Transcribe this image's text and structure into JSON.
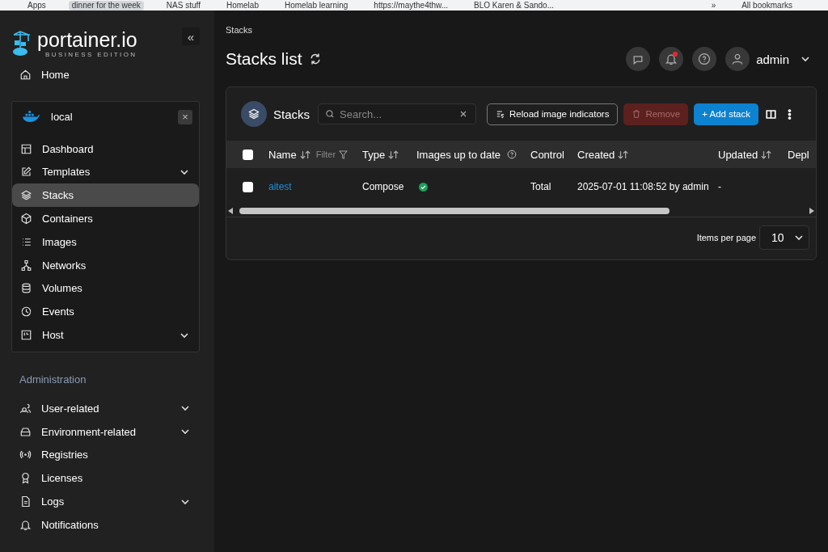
{
  "bookmarks": [
    {
      "label": "Apps",
      "selected": false
    },
    {
      "label": "dinner for the week",
      "selected": true
    },
    {
      "label": "NAS stuff",
      "selected": false
    },
    {
      "label": "Homelab",
      "selected": false
    },
    {
      "label": "Homelab learning",
      "selected": false
    },
    {
      "label": "https://maythe4thw...",
      "selected": false
    },
    {
      "label": "BLO Karen & Sando...",
      "selected": false
    }
  ],
  "bookmarks_more": "»",
  "all_bookmarks": "All bookmarks",
  "logo": {
    "name": "portainer.io",
    "edition": "BUSINESS EDITION"
  },
  "collapse_symbol": "«",
  "home": "Home",
  "environment": {
    "name": "local",
    "close": "×",
    "items": [
      {
        "label": "Dashboard",
        "selected": false
      },
      {
        "label": "Templates",
        "selected": false,
        "expanded": false
      },
      {
        "label": "Stacks",
        "selected": true
      },
      {
        "label": "Containers",
        "selected": false
      },
      {
        "label": "Images",
        "selected": false
      },
      {
        "label": "Networks",
        "selected": false
      },
      {
        "label": "Volumes",
        "selected": false
      },
      {
        "label": "Events",
        "selected": false
      },
      {
        "label": "Host",
        "selected": false,
        "expanded": false
      }
    ]
  },
  "admin_heading": "Administration",
  "admin_items": [
    {
      "label": "User-related",
      "expanded": false
    },
    {
      "label": "Environment-related",
      "expanded": false
    },
    {
      "label": "Registries"
    },
    {
      "label": "Licenses"
    },
    {
      "label": "Logs",
      "expanded": false
    },
    {
      "label": "Notifications"
    }
  ],
  "breadcrumb": "Stacks",
  "page_title": "Stacks list",
  "notifications": {
    "unread": true
  },
  "user": "admin",
  "panel": {
    "title": "Stacks",
    "search": {
      "placeholder": "Search..."
    },
    "reload_button": "Reload image indicators",
    "remove_button": {
      "label": "Remove",
      "disabled": true
    },
    "add_button": "+ Add stack"
  },
  "table": {
    "select_all": {
      "checked": false
    },
    "columns": [
      {
        "label": "Name",
        "sortable": true,
        "filter": "Filter"
      },
      {
        "label": "Type",
        "sortable": true
      },
      {
        "label": "Images up to date",
        "help": true
      },
      {
        "label": "Control"
      },
      {
        "label": "Created",
        "sortable": true
      },
      {
        "label": "Updated",
        "sortable": true
      },
      {
        "label": "Depl"
      }
    ],
    "rows": [
      {
        "checked": false,
        "name": "aitest",
        "type": "Compose",
        "up_to_date": true,
        "control": "Total",
        "created": "2025-07-01 11:08:52 by admin",
        "updated": "-"
      }
    ]
  },
  "pagination": {
    "label": "Items per page",
    "value": "10"
  }
}
